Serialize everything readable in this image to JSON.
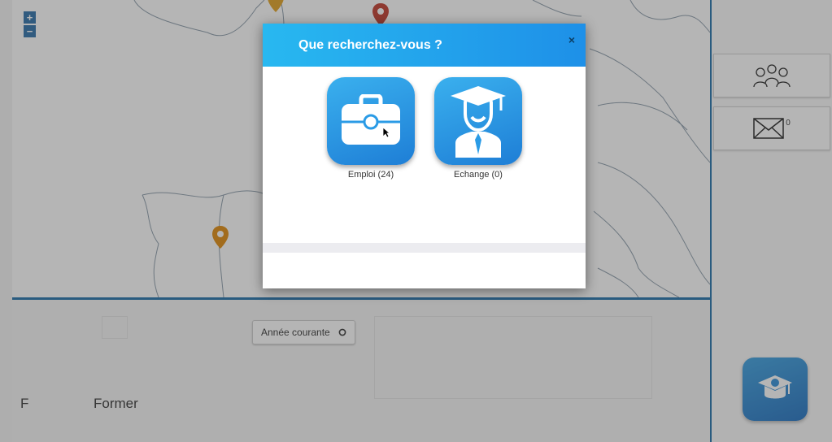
{
  "map": {
    "zoom_in": "+",
    "zoom_out": "−",
    "marker_colors": {
      "red": "#c0392b",
      "orange": "#e08a0a"
    }
  },
  "right_panel": {
    "group_icon": "group-of-people-icon",
    "mail_icon": "envelope-icon",
    "mail_count": "0",
    "app_logo_icon": "graduation-cap-globe-icon"
  },
  "bottom": {
    "year_button_label": "Année courante",
    "year_button_icon": "circle-icon",
    "label_f": "F",
    "label_former": "Former"
  },
  "modal": {
    "title": "Que recherchez-vous ?",
    "close_label": "×",
    "options": [
      {
        "label": "Emploi (24)",
        "icon": "briefcase-icon"
      },
      {
        "label": "Echange (0)",
        "icon": "graduate-student-icon"
      }
    ]
  },
  "colors": {
    "header_start": "#28b8f0",
    "header_end": "#1e90e8",
    "border_blue": "#1e6fa8"
  }
}
